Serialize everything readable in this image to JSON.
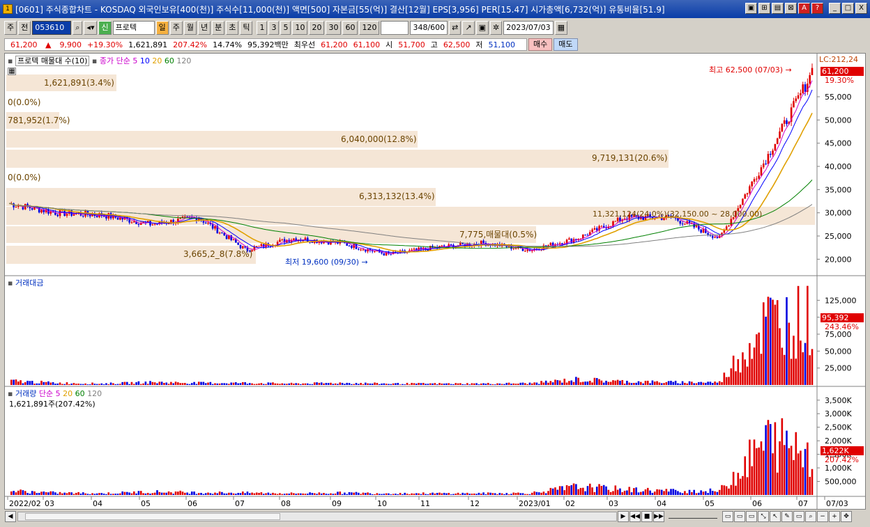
{
  "window": {
    "title": "[0601] 주식종합차트 - KOSDAQ 외국인보유[400(천)] 주식수[11,000(천)] 액면[500] 자본금[55(억)] 결산[12월] EPS[3,956] PER[15.47] 시가총액[6,732(억)] 유통비율[51.9]",
    "app_icon": "1",
    "buttons": [
      "▣",
      "⊞",
      "▤",
      "⊠",
      "A",
      "?",
      "_",
      "□",
      "X"
    ]
  },
  "toolbar": {
    "period_unit": "주",
    "prev_label": "전",
    "code": "053610",
    "search_type": "신",
    "search_value": "프로텍",
    "period_tabs": [
      "일",
      "주",
      "월",
      "년",
      "분",
      "초",
      "틱"
    ],
    "active_period": "일",
    "num_tabs": [
      "1",
      "3",
      "5",
      "10",
      "20",
      "30",
      "60",
      "120"
    ],
    "count": "348",
    "count_total": "/600",
    "date": "2023/07/03"
  },
  "quote": {
    "price": "61,200",
    "arrow": "▲",
    "change": "9,900",
    "change_pct": "+19.30%",
    "volume": "1,621,891",
    "vol_ratio": "207.42%",
    "turnover": "14.74%",
    "amount": "95,392백만",
    "best_label": "최우선",
    "best_ask": "61,200",
    "best_bid": "61,100",
    "open_label": "시",
    "open": "51,700",
    "high_label": "고",
    "high": "62,500",
    "low_label": "저",
    "low": "51,100",
    "buy_label": "매수",
    "sell_label": "매도"
  },
  "legend": {
    "price_pane": "프로텍 매물대 수(10)",
    "ma_label": "종가 단순",
    "ma_periods": [
      "5",
      "10",
      "20",
      "60",
      "120"
    ],
    "amount_pane": "거래대금",
    "volume_pane": "거래량",
    "volume_ma_label": "단순",
    "volume_ma_periods": [
      "5",
      "20",
      "60",
      "120"
    ],
    "volume_value": "1,621,891주(207.42%)"
  },
  "colors": {
    "up": "#e00000",
    "down": "#0000e0",
    "ma5": "#cc00cc",
    "ma10": "#0000ff",
    "ma20": "#e0a000",
    "ma60": "#008000",
    "ma120": "#808080",
    "volume_profile": "#f5e6d6"
  },
  "price_axis": {
    "lc_label": "LC:212,24",
    "current": "61,200",
    "current_pct": "19.30%",
    "ticks": [
      "55,000",
      "50,000",
      "45,000",
      "40,000",
      "35,000",
      "30,000",
      "25,000",
      "20,000"
    ]
  },
  "amount_axis": {
    "current": "95,392",
    "current_pct": "243.46%",
    "ticks": [
      "125,000",
      "100,000",
      "75,000",
      "50,000",
      "25,000"
    ]
  },
  "volume_axis": {
    "current": "1,622K",
    "current_pct": "207.42%",
    "ticks": [
      "3,500K",
      "3,000K",
      "2,500K",
      "2,000K",
      "1,500K",
      "1,000K",
      "500,000"
    ]
  },
  "annotations": {
    "high": "최고 62,500 (07/03)",
    "low": "최저 19,600 (09/30)",
    "overlap_text": "7,775,매물대(0.5%)",
    "range_text": "11,321,124(24.0%)(32,150.00 ~ 28,000.00)"
  },
  "volume_profile": [
    {
      "label": "1,621,891(3.4%)"
    },
    {
      "label": "0(0.0%)"
    },
    {
      "label": "781,952(1.7%)"
    },
    {
      "label": "6,040,000(12.8%)"
    },
    {
      "label": "9,719,131(20.6%)"
    },
    {
      "label": "0(0.0%)"
    },
    {
      "label": "6,313,132(13.4%)"
    },
    {
      "label": "11,321,124(24.0%)"
    },
    {
      "label": "7,775,매물대(0.5%)"
    },
    {
      "label": "3,665,2_8(7.8%)"
    }
  ],
  "x_axis": [
    "2022/02",
    "03",
    "04",
    "05",
    "06",
    "07",
    "08",
    "09",
    "10",
    "11",
    "12",
    "2023/01",
    "02",
    "03",
    "04",
    "05",
    "06",
    "07",
    "07/03"
  ],
  "chart_data": {
    "type": "line",
    "title": "",
    "xlabel": "",
    "ylabel": "",
    "ylim": [
      17500,
      62500
    ],
    "x": [
      "2022/02",
      "03",
      "04",
      "05",
      "06",
      "07",
      "08",
      "09",
      "10",
      "11",
      "12",
      "2023/01",
      "02",
      "03",
      "04",
      "05",
      "06",
      "07"
    ],
    "series": [
      {
        "name": "종가",
        "values": [
          32000,
          30000,
          29500,
          27500,
          29000,
          22000,
          24500,
          23500,
          21000,
          22500,
          23500,
          22000,
          24500,
          29000,
          29000,
          24500,
          42000,
          61200
        ]
      },
      {
        "name": "거래대금",
        "values": [
          6000,
          3000,
          2000,
          4000,
          3000,
          3000,
          2000,
          3000,
          2000,
          2000,
          2000,
          2500,
          8000,
          5000,
          4000,
          4000,
          95000,
          95392
        ]
      },
      {
        "name": "거래량",
        "values": [
          150000,
          80000,
          60000,
          120000,
          90000,
          80000,
          60000,
          80000,
          60000,
          60000,
          60000,
          70000,
          300000,
          200000,
          150000,
          150000,
          2000000,
          1621891
        ]
      }
    ]
  }
}
